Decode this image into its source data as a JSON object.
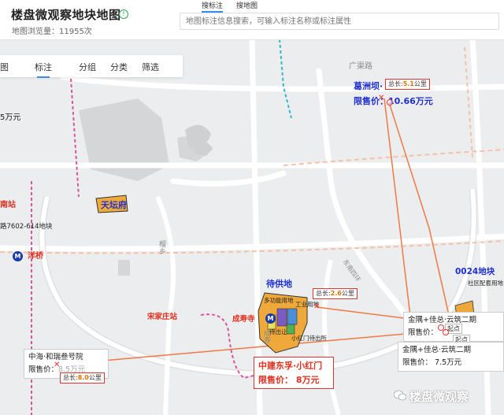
{
  "header": {
    "title": "楼盘微观察地块地图",
    "views": "地图浏览量：11955次",
    "search_tab_active": "搜标注",
    "search_tab_other": "搜地图",
    "search_placeholder": "地图标注信息搜索，可输入标注名称或标注属性"
  },
  "tabs": [
    "图",
    "标注",
    "分组",
    "分类",
    "筛选"
  ],
  "map": {
    "roads": {
      "guangqu": "广渠路",
      "yu_xiang": "榴乡",
      "cheng_shou": "成寿",
      "fen_zhong": "东南四环"
    },
    "places": {
      "tiantan_fu": "天坛府",
      "nan_zhan": "南站",
      "yangqiao": "洋桥",
      "plot_602": "路7602-614地块",
      "price_left": "5万元",
      "songjiazhuang": "宋家庄站",
      "chengshousi": "成寿寺",
      "daichu_di": "待供地",
      "duogong": "多功能用地",
      "gongye": "工业用地",
      "daichu_right": "待出让",
      "xiaohongmen_out": "小红门待出所",
      "plot_0024": "0024地块",
      "shequ": "社区配套用地",
      "kou": "口"
    },
    "gezhouba": {
      "name": "葛洲坝·",
      "dist_label": "总长:",
      "dist_value": "5.1",
      "dist_unit": "公里",
      "price": "限售价：10.66万元"
    },
    "center_measure": {
      "dist_label": "总长:",
      "dist_value": "2.6",
      "dist_unit": "公里"
    },
    "zhonghai": {
      "name": "中海·和瑞叁号院",
      "price": "限售价：",
      "price_hidden": "8.5万元",
      "dist_label": "总长:",
      "dist_value": "8.0",
      "dist_unit": "公里"
    },
    "jinyu1": {
      "name": "金隅+佳总·云筑二期",
      "price": "限售价："
    },
    "jinyu2": {
      "name": "金隅+佳总·云筑二期",
      "price": "限售价：   7.5万元"
    },
    "qidian1": "起点",
    "qidian2": "起点",
    "promo": {
      "name": "中建东孚·小红门",
      "price": "限售价：  8万元"
    },
    "metro_symbol": "M"
  },
  "watermark": "楼盘微观察",
  "colors": {
    "orange_route": "#f07844",
    "metro_pink": "#d8579b",
    "metro_cyan": "#32b8c8",
    "subway_blue": "#1a3aa8"
  }
}
